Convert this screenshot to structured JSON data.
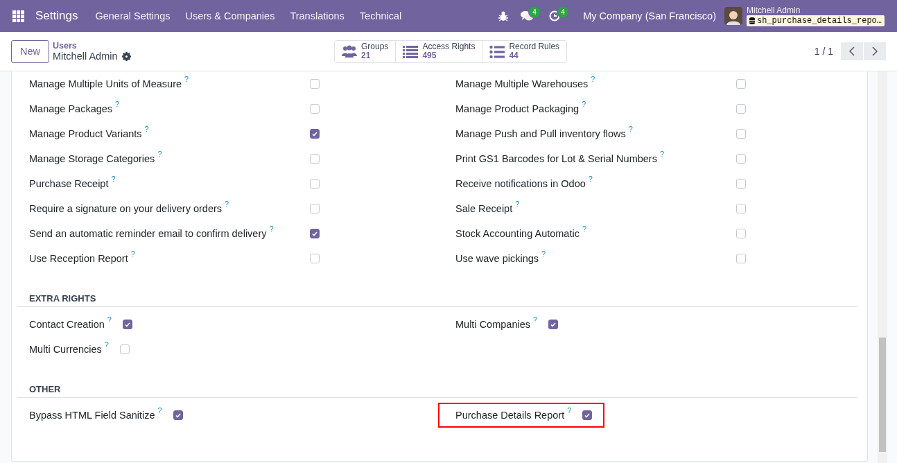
{
  "navbar": {
    "app_name": "Settings",
    "menu": [
      "General Settings",
      "Users & Companies",
      "Translations",
      "Technical"
    ],
    "messages_badge": "4",
    "activities_badge": "4",
    "company": "My Company (San Francisco)",
    "user_name": "Mitchell Admin",
    "database": "sh_purchase_details_repo…"
  },
  "control_panel": {
    "new_button": "New",
    "breadcrumb": "Users",
    "record": "Mitchell Admin",
    "stats": [
      {
        "kind": "groups",
        "label": "Groups",
        "value": "21"
      },
      {
        "kind": "list",
        "label": "Access Rights",
        "value": "495"
      },
      {
        "kind": "bullets",
        "label": "Record Rules",
        "value": "44"
      }
    ],
    "pager": "1 / 1"
  },
  "sections": [
    {
      "kind": "aligned",
      "items": [
        {
          "label": "Manage Multiple Units of Measure",
          "help": "?",
          "checked": false,
          "highlighted": false
        },
        {
          "label": "Manage Multiple Warehouses",
          "help": "?",
          "checked": false,
          "highlighted": false
        },
        {
          "label": "Manage Packages",
          "help": "?",
          "checked": false,
          "highlighted": false
        },
        {
          "label": "Manage Product Packaging",
          "help": "?",
          "checked": false,
          "highlighted": false
        },
        {
          "label": "Manage Product Variants",
          "help": "?",
          "checked": true,
          "highlighted": false
        },
        {
          "label": "Manage Push and Pull inventory flows",
          "help": "?",
          "checked": false,
          "highlighted": false
        },
        {
          "label": "Manage Storage Categories",
          "help": "?",
          "checked": false,
          "highlighted": false
        },
        {
          "label": "Print GS1 Barcodes for Lot & Serial Numbers",
          "help": "?",
          "checked": false,
          "highlighted": false
        },
        {
          "label": "Purchase Receipt",
          "help": "?",
          "checked": false,
          "highlighted": false
        },
        {
          "label": "Receive notifications in Odoo",
          "help": "?",
          "checked": false,
          "highlighted": false
        },
        {
          "label": "Require a signature on your delivery orders",
          "help": "?",
          "checked": false,
          "highlighted": false
        },
        {
          "label": "Sale Receipt",
          "help": "?",
          "checked": false,
          "highlighted": false
        },
        {
          "label": "Send an automatic reminder email to confirm delivery",
          "help": "?",
          "checked": true,
          "highlighted": false
        },
        {
          "label": "Stock Accounting Automatic",
          "help": "?",
          "checked": false,
          "highlighted": false
        },
        {
          "label": "Use Reception Report",
          "help": "?",
          "checked": false,
          "highlighted": false
        },
        {
          "label": "Use wave pickings",
          "help": "?",
          "checked": false,
          "highlighted": false
        }
      ]
    },
    {
      "title": "EXTRA RIGHTS",
      "kind": "inline",
      "items": [
        {
          "label": "Contact Creation",
          "help": "?",
          "checked": true,
          "highlighted": false
        },
        {
          "label": "Multi Companies",
          "help": "?",
          "checked": true,
          "highlighted": false
        },
        {
          "label": "Multi Currencies",
          "help": "?",
          "checked": false,
          "highlighted": false
        }
      ]
    },
    {
      "title": "OTHER",
      "kind": "inline",
      "items": [
        {
          "label": "Bypass HTML Field Sanitize",
          "help": "?",
          "checked": true,
          "highlighted": false
        },
        {
          "label": "Purchase Details Report",
          "help": "?",
          "checked": true,
          "highlighted": true
        }
      ]
    }
  ]
}
